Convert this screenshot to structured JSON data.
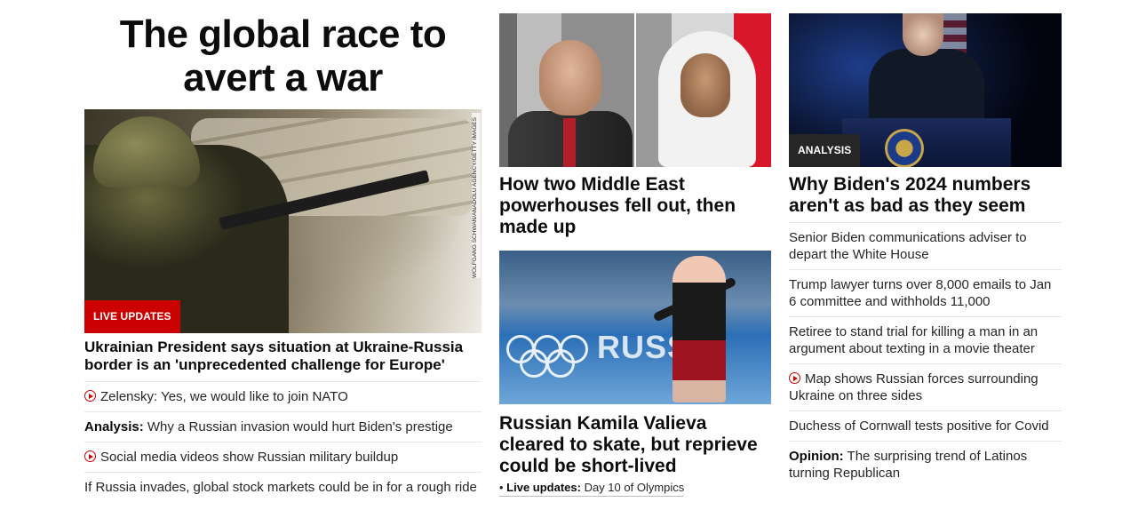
{
  "col1": {
    "hero_title": "The global race to avert a war",
    "image_credit": "WOLFGANG SCHWAN/ANADOLU AGENCY/GETTY IMAGES",
    "badge": "LIVE UPDATES",
    "headline": "Ukrainian President says situation at Ukraine-Russia border is an 'unprecedented challenge for Europe'",
    "links": [
      {
        "prefix": "",
        "text": "Zelensky: Yes, we would like to join NATO",
        "video": true
      },
      {
        "prefix": "Analysis:",
        "text": " Why a Russian invasion would hurt Biden's prestige",
        "video": false
      },
      {
        "prefix": "",
        "text": "Social media videos show Russian military buildup",
        "video": true
      },
      {
        "prefix": "",
        "text": "If Russia invades, global stock markets could be in for a rough ride",
        "video": false
      }
    ]
  },
  "col2": {
    "story1_headline": "How two Middle East powerhouses fell out, then made up",
    "story2_headline": "Russian Kamila Valieva cleared to skate, but reprieve could be short-lived",
    "skate_backdrop_text": "RUSSIA",
    "live_sub": {
      "bullet": "• ",
      "label": "Live updates:",
      "text": " Day 10 of Olympics"
    }
  },
  "col3": {
    "badge": "ANALYSIS",
    "headline": "Why Biden's 2024 numbers aren't as bad as they seem",
    "links": [
      {
        "prefix": "",
        "text": "Senior Biden communications adviser to depart the White House",
        "video": false
      },
      {
        "prefix": "",
        "text": "Trump lawyer turns over 8,000 emails to Jan 6 committee and withholds 11,000",
        "video": false
      },
      {
        "prefix": "",
        "text": "Retiree to stand trial for killing a man in an argument about texting in a movie theater",
        "video": false
      },
      {
        "prefix": "",
        "text": "Map shows Russian forces surrounding Ukraine on three sides",
        "video": true
      },
      {
        "prefix": "",
        "text": "Duchess of Cornwall tests positive for Covid",
        "video": false
      },
      {
        "prefix": "Opinion:",
        "text": " The surprising trend of Latinos turning Republican",
        "video": false
      }
    ]
  },
  "colors": {
    "live_red": "#cc0000",
    "analysis_badge": "#262626",
    "text": "#0c0c0c",
    "divider": "#e6e6e6"
  },
  "icons": {
    "video": "play-circle-icon"
  }
}
